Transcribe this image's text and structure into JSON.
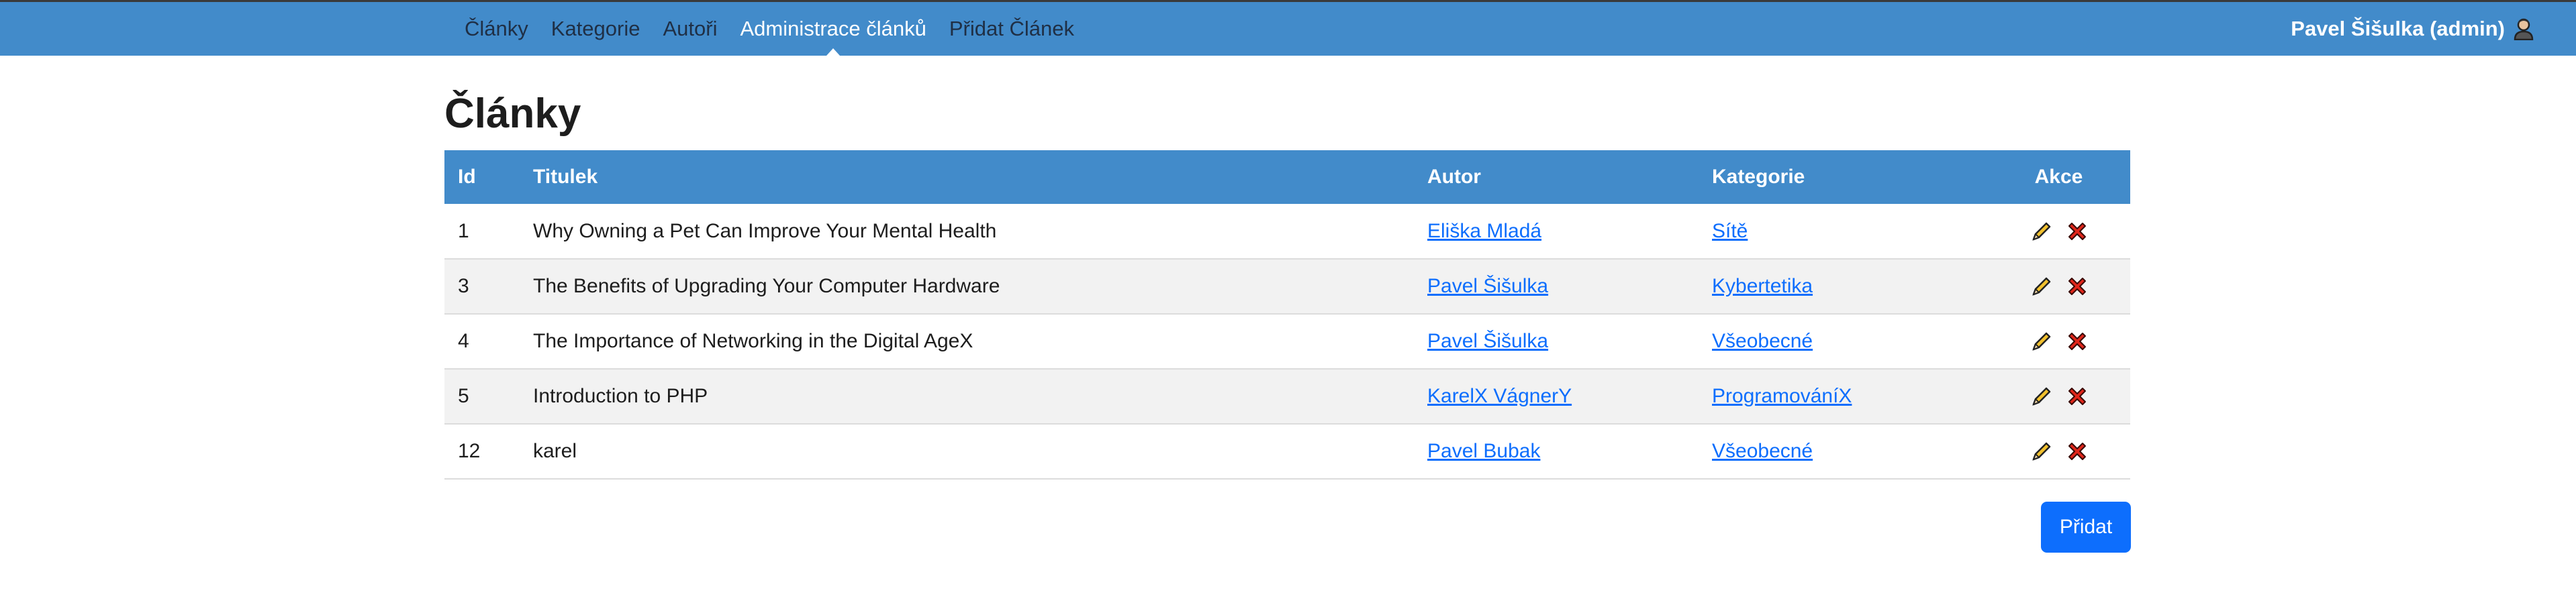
{
  "nav": {
    "items": [
      {
        "label": "Články",
        "active": false
      },
      {
        "label": "Kategorie",
        "active": false
      },
      {
        "label": "Autoři",
        "active": false
      },
      {
        "label": "Administrace článků",
        "active": true
      },
      {
        "label": "Přidat Článek",
        "active": false
      }
    ],
    "user_label": "Pavel Šišulka (admin)",
    "user_icon": "user-icon"
  },
  "page": {
    "title": "Články"
  },
  "table": {
    "headers": {
      "id": "Id",
      "title": "Titulek",
      "author": "Autor",
      "category": "Kategorie",
      "actions": "Akce"
    },
    "rows": [
      {
        "id": "1",
        "title": "Why Owning a Pet Can Improve Your Mental Health",
        "author": "Eliška Mladá",
        "category": "Sítě"
      },
      {
        "id": "3",
        "title": "The Benefits of Upgrading Your Computer Hardware",
        "author": "Pavel Šišulka",
        "category": "Kybertetika"
      },
      {
        "id": "4",
        "title": "The Importance of Networking in the Digital AgeX",
        "author": "Pavel Šišulka",
        "category": "Všeobecné"
      },
      {
        "id": "5",
        "title": "Introduction to PHP",
        "author": "KarelX VágnerY",
        "category": "ProgramováníX"
      },
      {
        "id": "12",
        "title": "karel",
        "author": "Pavel Bubak",
        "category": "Všeobecné"
      }
    ],
    "action_icons": [
      "pencil-icon",
      "delete-x-icon"
    ]
  },
  "buttons": {
    "add_label": "Přidat"
  },
  "colors": {
    "navbar": "#428bca",
    "header_row": "#428bca",
    "link": "#0d6efd",
    "button": "#0d6efd",
    "pencil": "#f2c12e",
    "delete": "#e0261b"
  }
}
